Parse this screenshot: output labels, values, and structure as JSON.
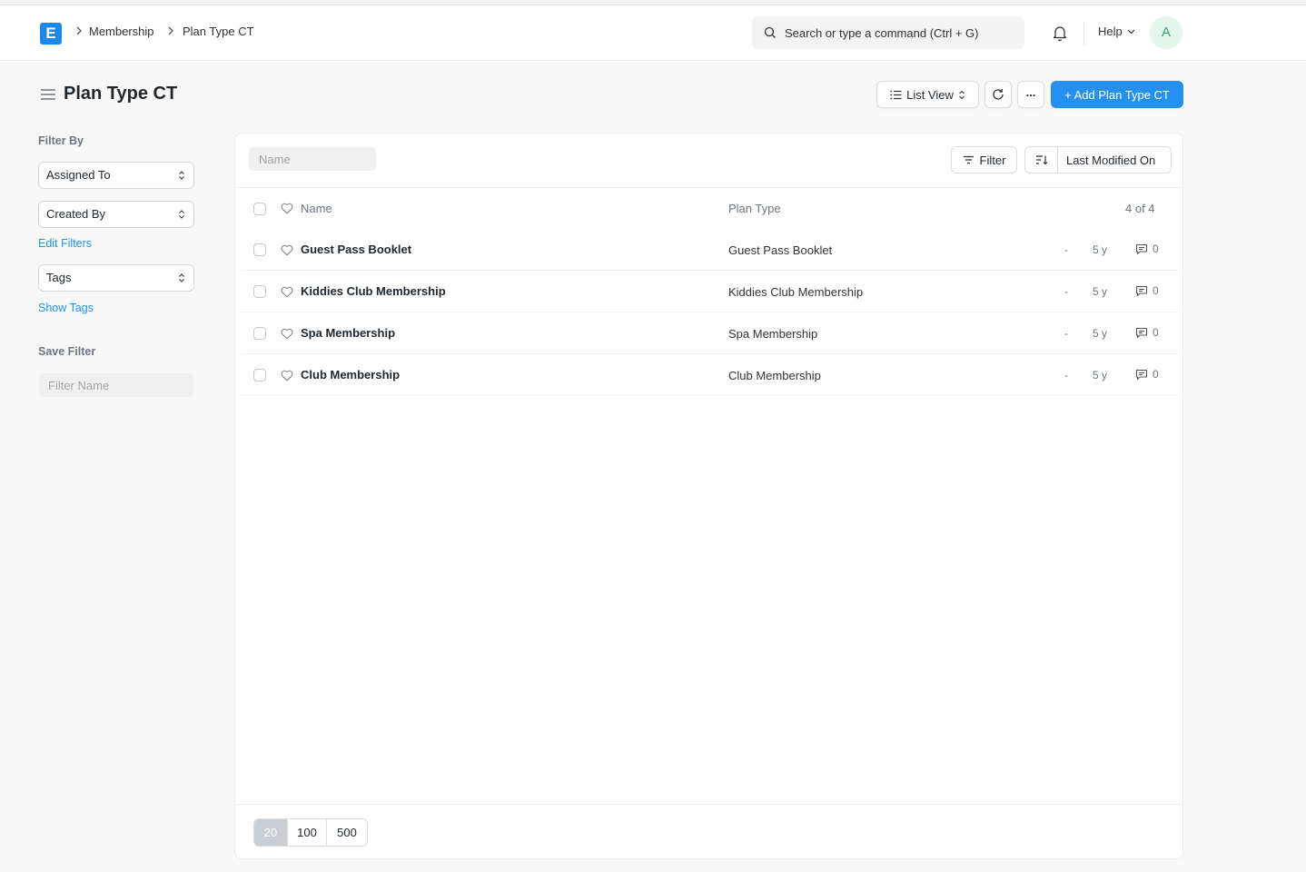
{
  "navbar": {
    "logo_letter": "E",
    "breadcrumbs": [
      "Membership",
      "Plan Type CT"
    ],
    "search_placeholder": "Search or type a command (Ctrl + G)",
    "help_label": "Help",
    "avatar_initial": "A"
  },
  "page": {
    "title": "Plan Type CT",
    "view_switcher_label": "List View",
    "more_label": "...",
    "add_button_label": "+ Add Plan Type CT"
  },
  "sidebar": {
    "filter_by_label": "Filter By",
    "assigned_to_label": "Assigned To",
    "created_by_label": "Created By",
    "edit_filters_label": "Edit Filters",
    "tags_label": "Tags",
    "show_tags_label": "Show Tags",
    "save_filter_label": "Save Filter",
    "filter_name_placeholder": "Filter Name"
  },
  "list": {
    "name_filter_placeholder": "Name",
    "filter_button_label": "Filter",
    "sort_label": "Last Modified On",
    "columns": {
      "name": "Name",
      "plan_type": "Plan Type"
    },
    "count_label": "4 of 4",
    "rows": [
      {
        "name": "Guest Pass Booklet",
        "plan_type": "Guest Pass Booklet",
        "status": "-",
        "modified": "5 y",
        "comments": "0"
      },
      {
        "name": "Kiddies Club Membership",
        "plan_type": "Kiddies Club Membership",
        "status": "-",
        "modified": "5 y",
        "comments": "0"
      },
      {
        "name": "Spa Membership",
        "plan_type": "Spa Membership",
        "status": "-",
        "modified": "5 y",
        "comments": "0"
      },
      {
        "name": "Club Membership",
        "plan_type": "Club Membership",
        "status": "-",
        "modified": "5 y",
        "comments": "0"
      }
    ],
    "page_sizes": [
      "20",
      "100",
      "500"
    ],
    "selected_page_size": "20"
  },
  "colors": {
    "primary": "#2490ef",
    "logo": "#1e88e5",
    "avatar_bg": "#e4f5e9",
    "avatar_text": "#30a66d"
  }
}
